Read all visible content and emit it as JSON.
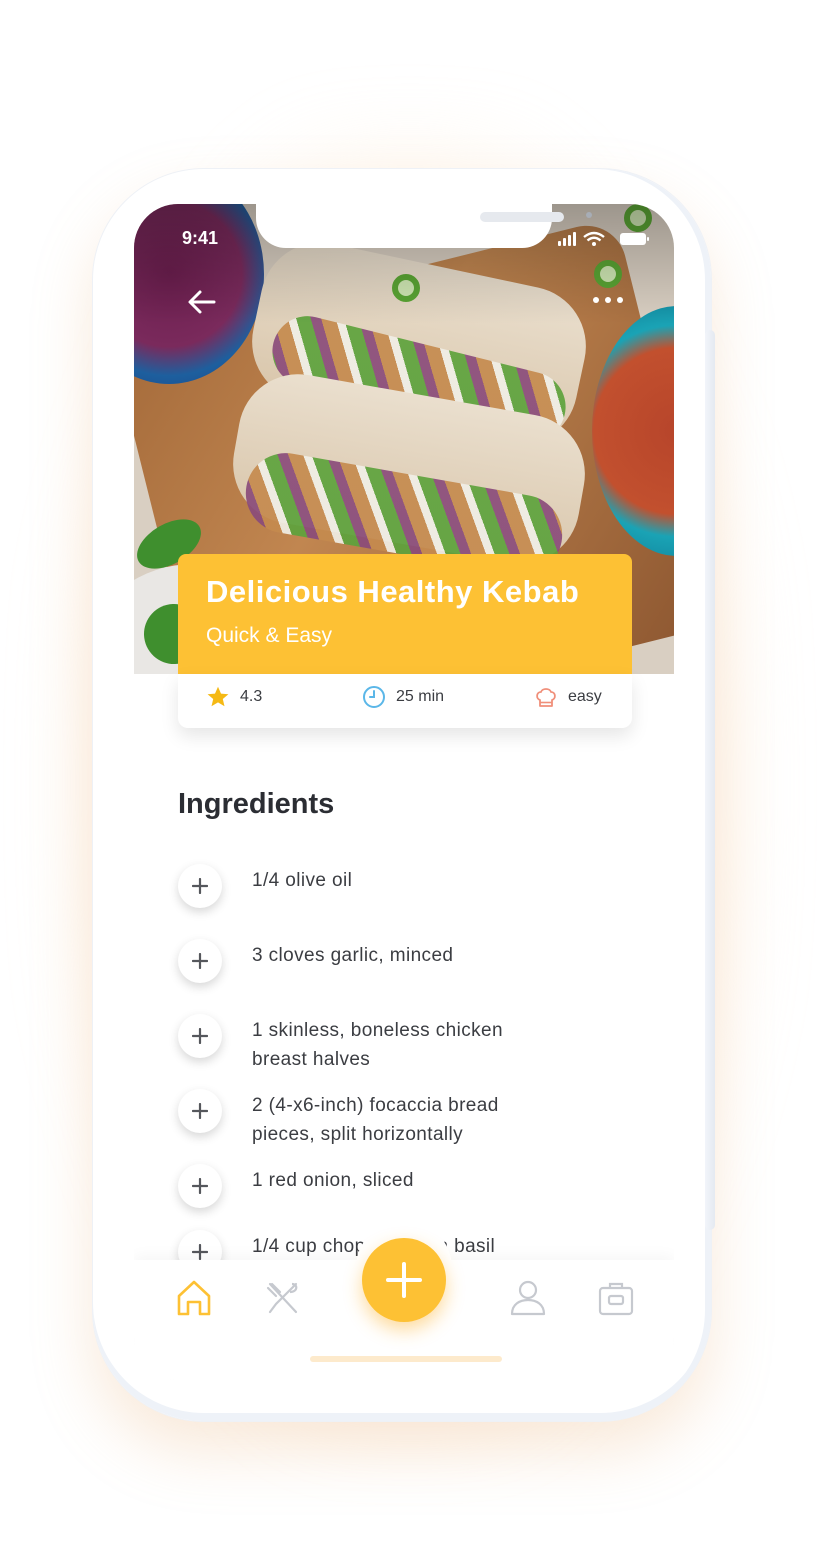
{
  "status_bar": {
    "time": "9:41"
  },
  "recipe": {
    "title": "Delicious Healthy Kebab",
    "subtitle": "Quick & Easy",
    "rating": "4.3",
    "duration": "25 min",
    "difficulty": "easy"
  },
  "ingredients": {
    "heading": "Ingredients",
    "items": [
      "1/4 olive oil",
      "3 cloves garlic, minced",
      "1 skinless, boneless chicken breast halves",
      "2 (4-x6-inch) focaccia bread pieces, split horizontally",
      "1 red onion, sliced",
      "1/4 cup chopped fresh basil"
    ]
  },
  "icons": {
    "back": "arrow-left-icon",
    "more": "more-dots-icon",
    "rating": "star-icon",
    "time": "clock-icon",
    "difficulty": "chef-hat-icon",
    "add": "plus-icon",
    "tabs": [
      "home-icon",
      "utensils-icon",
      "add-icon",
      "user-icon",
      "bag-icon"
    ]
  },
  "colors": {
    "accent": "#fdc134",
    "star": "#f5b914",
    "clock": "#5bb7e8",
    "chef_hat": "#f08f7a",
    "text_dark": "#2b2d33",
    "tab_active": "#fdc134",
    "tab_inactive": "#c6c9cf"
  }
}
